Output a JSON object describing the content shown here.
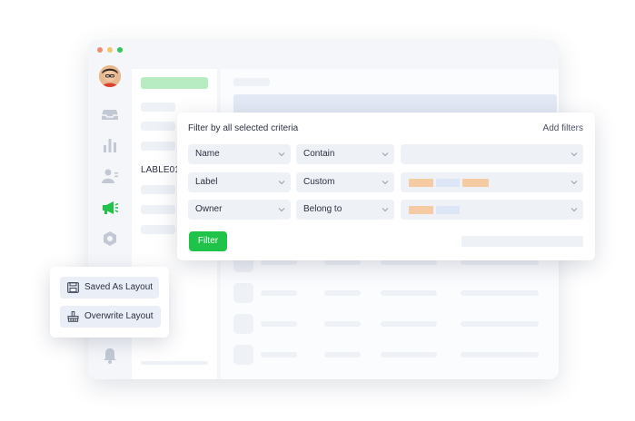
{
  "filter": {
    "title": "Filter by all selected criteria",
    "add_filters": "Add filters",
    "rows": [
      {
        "field": "Name",
        "operator": "Contain"
      },
      {
        "field": "Label",
        "operator": "Custom"
      },
      {
        "field": "Owner",
        "operator": "Belong to"
      }
    ],
    "button": "Filter"
  },
  "list": {
    "label": "LABLE01"
  },
  "layout_menu": {
    "saved_as": "Saved As Layout",
    "overwrite": "Overwrite Layout"
  },
  "colors": {
    "accent": "#1fc34a",
    "chip_orange": "#f4cba2",
    "chip_blue": "#dde6f6",
    "panel_bg": "#eef1f6"
  },
  "icons": [
    "inbox-icon",
    "bar-chart-icon",
    "contacts-icon",
    "megaphone-icon",
    "settings-icon",
    "bell-icon",
    "save-icon",
    "overwrite-icon",
    "chevron-down-icon"
  ]
}
